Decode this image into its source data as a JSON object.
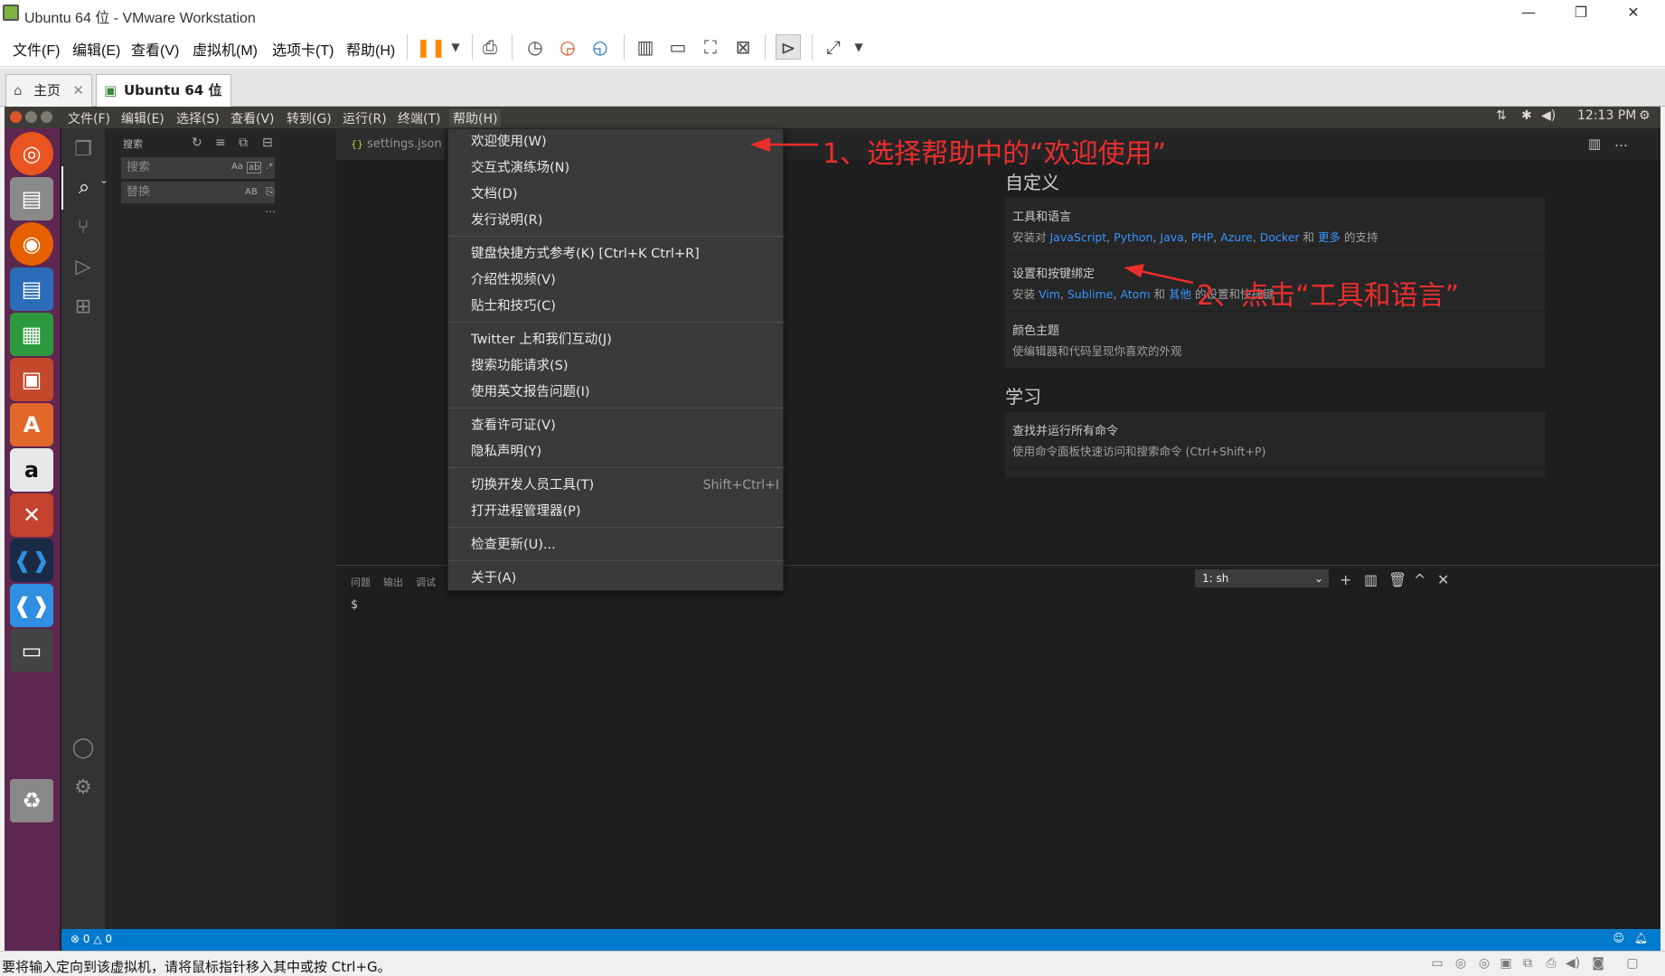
{
  "window": {
    "title": "Ubuntu 64 位 - VMware Workstation"
  },
  "vm_menu": [
    "文件(F)",
    "编辑(E)",
    "查看(V)",
    "虚拟机(M)",
    "选项卡(T)",
    "帮助(H)"
  ],
  "vm_tabs": [
    {
      "label": "主页",
      "icon": "home-icon"
    },
    {
      "label": "Ubuntu 64 位",
      "icon": "vm-icon"
    }
  ],
  "ubuntu_top": {
    "menus": [
      "文件(F)",
      "编辑(E)",
      "选择(S)",
      "查看(V)",
      "转到(G)",
      "运行(R)",
      "终端(T)",
      "帮助(H)"
    ],
    "time": "12:13 PM"
  },
  "sidebar": {
    "title": "搜索",
    "search_placeholder": "搜索",
    "replace_placeholder": "替换",
    "case_opt": "Aa",
    "word_opt": "ab",
    "regex_opt": ".*",
    "preserve_case": "AB"
  },
  "editor": {
    "tab": "settings.json",
    "customize_heading": "自定义",
    "learn_heading": "学习",
    "cards": [
      {
        "title": "工具和语言",
        "prefix": "安装对 ",
        "links": [
          "JavaScript",
          "Python",
          "Java",
          "PHP",
          "Azure",
          "Docker"
        ],
        "and": " 和 ",
        "more": "更多",
        "suffix": " 的支持"
      },
      {
        "title": "设置和按键绑定",
        "prefix": "安装 ",
        "links": [
          "Vim",
          "Sublime",
          "Atom"
        ],
        "and": " 和 ",
        "more": "其他",
        "suffix": " 的设置和快捷键"
      },
      {
        "title": "颜色主题",
        "desc": "使编辑器和代码呈现你喜欢的外观"
      },
      {
        "title": "查找并运行所有命令",
        "desc": "使用命令面板快速访问和搜索命令 (Ctrl+Shift+P)"
      }
    ]
  },
  "panel": {
    "tabs": [
      "问题",
      "输出",
      "调试"
    ],
    "terminal_select": "1: sh",
    "prompt": "$"
  },
  "help_menu": {
    "items": [
      {
        "label": "欢迎使用(W)"
      },
      {
        "label": "交互式演练场(N)"
      },
      {
        "label": "文档(D)"
      },
      {
        "label": "发行说明(R)"
      },
      {
        "label": "键盘快捷方式参考(K) [Ctrl+K Ctrl+R]"
      },
      {
        "label": "介绍性视频(V)"
      },
      {
        "label": "贴士和技巧(C)"
      },
      {
        "label": "Twitter 上和我们互动(J)"
      },
      {
        "label": "搜索功能请求(S)"
      },
      {
        "label": "使用英文报告问题(I)"
      },
      {
        "label": "查看许可证(V)"
      },
      {
        "label": "隐私声明(Y)"
      },
      {
        "label": "切换开发人员工具(T)",
        "shortcut": "Shift+Ctrl+I"
      },
      {
        "label": "打开进程管理器(P)"
      },
      {
        "label": "检查更新(U)..."
      },
      {
        "label": "关于(A)"
      }
    ]
  },
  "status": {
    "errors": "0",
    "warnings": "0"
  },
  "annotations": {
    "step1": "1、选择帮助中的“欢迎使用”",
    "step2": "2、点击“工具和语言”",
    "color": "#ec2d2d"
  },
  "host_status": "要将输入定向到该虚拟机，请将鼠标指针移入其中或按 Ctrl+G。"
}
